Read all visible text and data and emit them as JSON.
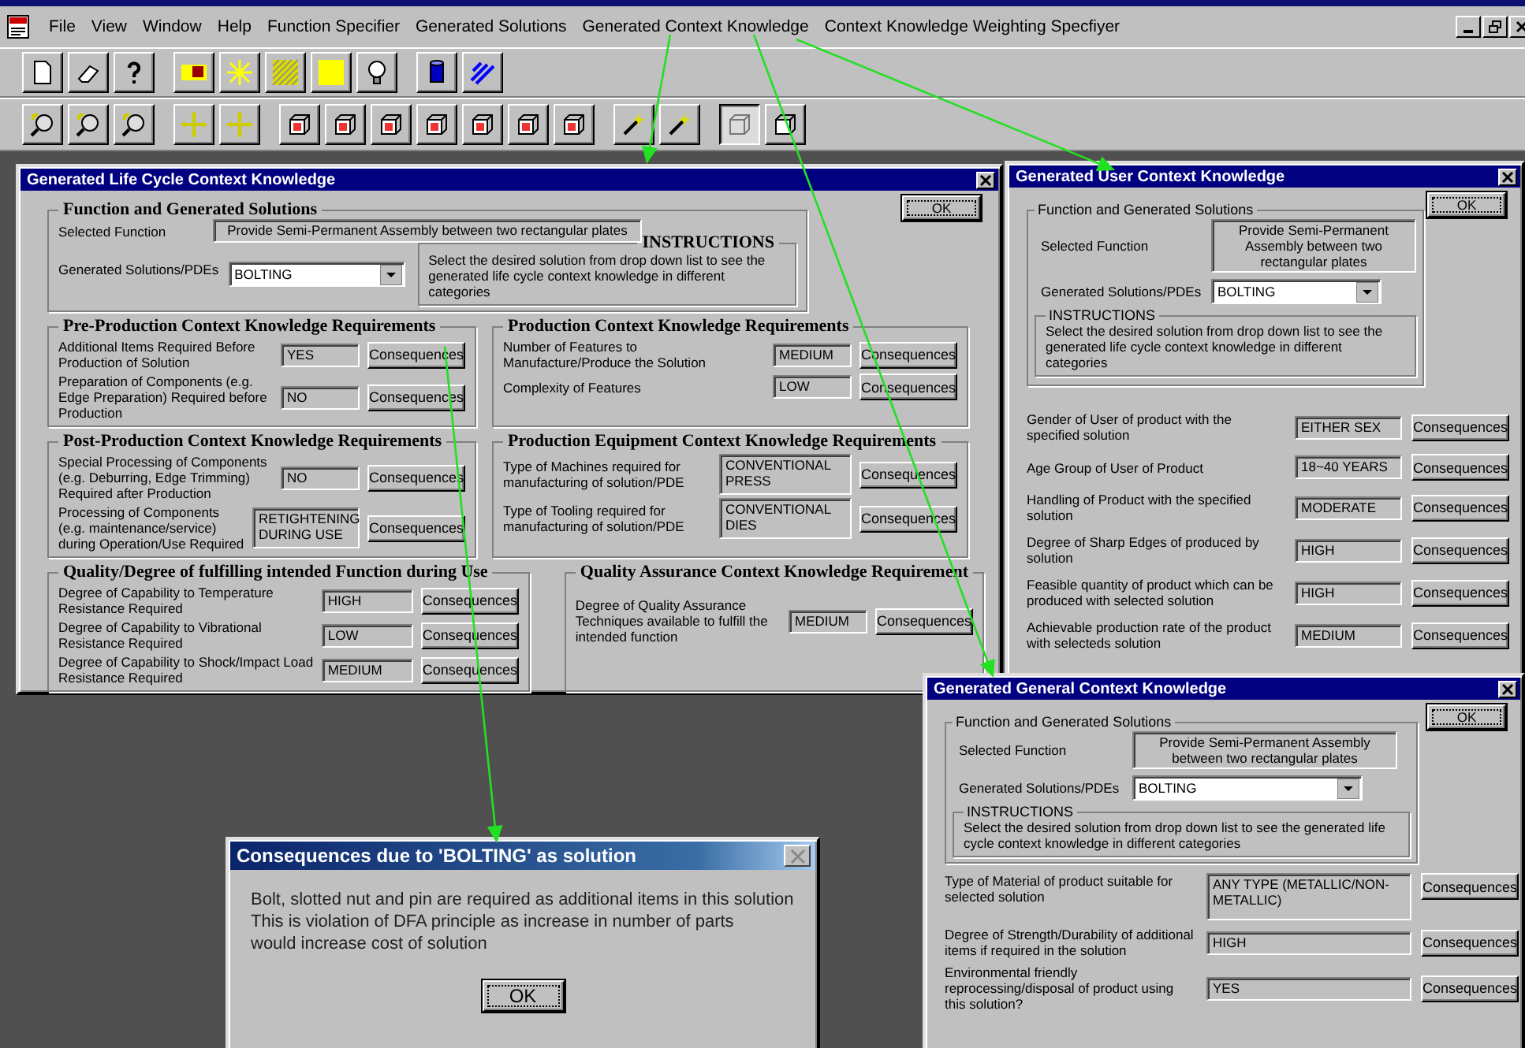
{
  "menu_bar": {
    "items": [
      "File",
      "View",
      "Window",
      "Help",
      "Function Specifier",
      "Generated Solutions",
      "Generated Context Knowledge",
      "Context Knowledge Weighting Specfiyer"
    ]
  },
  "view_toolbar": {
    "buttons": [
      {
        "pressed": false
      },
      {
        "pressed": false
      },
      {
        "pressed": false
      },
      {
        "pressed": false
      },
      {
        "pressed": false
      },
      {
        "pressed": false
      },
      {
        "pressed": false
      },
      {
        "pressed": false
      },
      {
        "pressed": false
      },
      {
        "pressed": false
      },
      {
        "pressed": false
      },
      {
        "pressed": false
      },
      {
        "pressed": false
      },
      {
        "pressed": false
      },
      {
        "pressed": true
      },
      {
        "pressed": false
      }
    ]
  },
  "life_cycle_window": {
    "title": "Generated Life Cycle Context Knowledge",
    "ok": "OK",
    "function_group": {
      "title": "Function and Generated Solutions",
      "selected_function_label": "Selected Function",
      "selected_function": "Provide Semi-Permanent Assembly between two rectangular plates",
      "solutions_label": "Generated Solutions/PDEs",
      "solution": "BOLTING",
      "instructions_title": "INSTRUCTIONS",
      "instructions": "Select the desired solution from drop down list to see the generated life cycle context knowledge in different categories"
    },
    "group_rows": [
      [
        {
          "title": "Pre-Production Context Knowledge Requirements",
          "rows": [
            {
              "label": "Additional Items  Required Before Production of Solution",
              "value": "YES",
              "button": "Consequences"
            },
            {
              "label": "Preparation of Components (e.g. Edge Preparation) Required before Production",
              "value": "NO",
              "button": "Consequences"
            }
          ]
        },
        {
          "title": "Production Context Knowledge Requirements",
          "rows": [
            {
              "label": "Number of Features to Manufacture/Produce the Solution",
              "value": "MEDIUM",
              "button": "Consequences"
            },
            {
              "label": "Complexity of Features",
              "value": "LOW",
              "button": "Consequences"
            }
          ]
        }
      ],
      [
        {
          "title": "Post-Production Context Knowledge Requirements",
          "rows": [
            {
              "label": "Special Processing of Components (e.g. Deburring, Edge Trimming)  Required after Production",
              "value": "NO",
              "button": "Consequences"
            },
            {
              "label": "Processing of Components (e.g. maintenance/service) during Operation/Use Required",
              "value": "RETIGHTENING DURING USE",
              "button": "Consequences"
            }
          ]
        },
        {
          "title": "Production Equipment Context Knowledge Requirements",
          "rows": [
            {
              "label": "Type of Machines required for manufacturing of solution/PDE",
              "value": "CONVENTIONAL PRESS",
              "button": "Consequences"
            },
            {
              "label": "Type of Tooling required for manufacturing of solution/PDE",
              "value": "CONVENTIONAL DIES",
              "button": "Consequences"
            }
          ]
        }
      ],
      [
        {
          "title": "Quality/Degree of fulfilling intended Function during Use",
          "rows": [
            {
              "label": "Degree of Capability to Temperature Resistance Required",
              "value": "HIGH",
              "button": "Consequences"
            },
            {
              "label": "Degree of Capability to Vibrational Resistance Required",
              "value": "LOW",
              "button": "Consequences"
            },
            {
              "label": "Degree of Capability to Shock/Impact Load Resistance Required",
              "value": "MEDIUM",
              "button": "Consequences"
            }
          ]
        },
        {
          "title": "Quality Assurance Context Knowledge Requirement",
          "rows": [
            {
              "label": "Degree of Quality Assurance Techniques available to fulfill the intended function",
              "value": "MEDIUM",
              "button": "Consequences"
            }
          ]
        }
      ]
    ]
  },
  "user_window": {
    "title": "Generated User Context Knowledge",
    "ok": "OK",
    "function_group": {
      "title": "Function and Generated Solutions",
      "selected_function_label": "Selected Function",
      "selected_function": "Provide Semi-Permanent Assembly between two rectangular plates",
      "solutions_label": "Generated Solutions/PDEs",
      "solution": "BOLTING",
      "instructions_title": "INSTRUCTIONS",
      "instructions": "Select the desired solution from drop down list to see the generated life cycle context knowledge in different categories"
    },
    "rows": [
      {
        "label": "Gender of User of product with the specified solution",
        "value": "EITHER SEX",
        "button": "Consequences"
      },
      {
        "label": "Age Group of User of Product",
        "value": "18~40 YEARS",
        "button": "Consequences"
      },
      {
        "label": "Handling of Product with the specified solution",
        "value": "MODERATE",
        "button": "Consequences"
      },
      {
        "label": "Degree of Sharp Edges of produced by solution",
        "value": "HIGH",
        "button": "Consequences"
      },
      {
        "label": "Feasible quantity of product which can be produced with selected solution",
        "value": "HIGH",
        "button": "Consequences"
      },
      {
        "label": "Achievable production rate of the product with selecteds solution",
        "value": "MEDIUM",
        "button": "Consequences"
      }
    ]
  },
  "general_window": {
    "title": "Generated General Context Knowledge",
    "ok": "OK",
    "function_group": {
      "title": "Function and Generated Solutions",
      "selected_function_label": "Selected Function",
      "selected_function": "Provide Semi-Permanent Assembly between two rectangular plates",
      "solutions_label": "Generated Solutions/PDEs",
      "solution": "BOLTING",
      "instructions_title": "INSTRUCTIONS",
      "instructions": "Select the desired solution from drop down list to see the generated life cycle context knowledge in different categories"
    },
    "rows": [
      {
        "label": "Type of Material of product suitable for selected solution",
        "value": "ANY TYPE (METALLIC/NON-METALLIC)",
        "button": "Consequences"
      },
      {
        "label": "Degree of Strength/Durability of additional items if required in the solution",
        "value": "HIGH",
        "button": "Consequences"
      },
      {
        "label": "Environmental friendly reprocessing/disposal of product using this solution?",
        "value": "YES",
        "button": "Consequences"
      }
    ]
  },
  "message_dialog": {
    "title": "Consequences due to 'BOLTING' as solution",
    "message": "Bolt, slotted nut and pin are required as additional items in this solution\nThis is violation of DFA principle as increase in number of parts\nwould increase cost of solution",
    "ok": "OK"
  }
}
